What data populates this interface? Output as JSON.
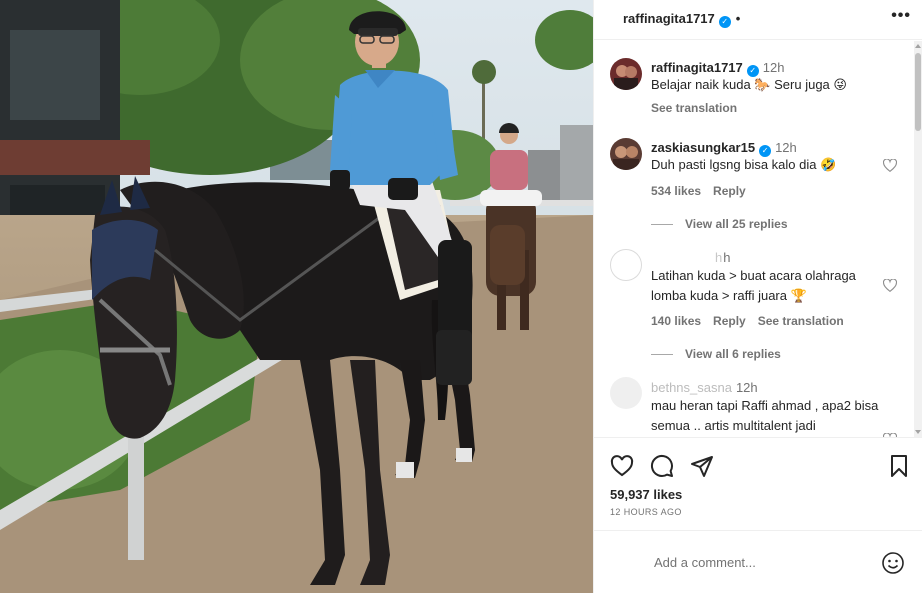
{
  "post": {
    "username": "raffinagita1717",
    "more_icon": "•••",
    "separator": "•"
  },
  "caption": {
    "username": "raffinagita1717",
    "time": "12h",
    "text": "Belajar naik kuda 🐎 Seru juga 😜",
    "see_translation": "See translation"
  },
  "comments": [
    {
      "username": "zaskiasungkar15",
      "verified": true,
      "time": "12h",
      "text": "Duh pasti lgsng bisa kalo dia 🤣",
      "likes": "534 likes",
      "reply": "Reply",
      "view_replies": "View all 25 replies"
    },
    {
      "username": "h",
      "time": "h",
      "text": "Latihan kuda > buat acara olahraga lomba kuda > raffi juara 🏆",
      "likes": "140 likes",
      "reply": "Reply",
      "see_translation": "See translation",
      "view_replies": "View all 6 replies"
    },
    {
      "username": "bethns_sasna",
      "time": "12h",
      "text": "mau heran tapi Raffi ahmad , apa2 bisa semua .. artis multitalent jadi"
    }
  ],
  "actions": {
    "likes": "59,937 likes",
    "time_ago": "12 HOURS AGO"
  },
  "add_comment": {
    "placeholder": "Add a comment..."
  },
  "colors": {
    "verified": "#0095f6",
    "text": "#262626",
    "secondary": "#737373"
  }
}
